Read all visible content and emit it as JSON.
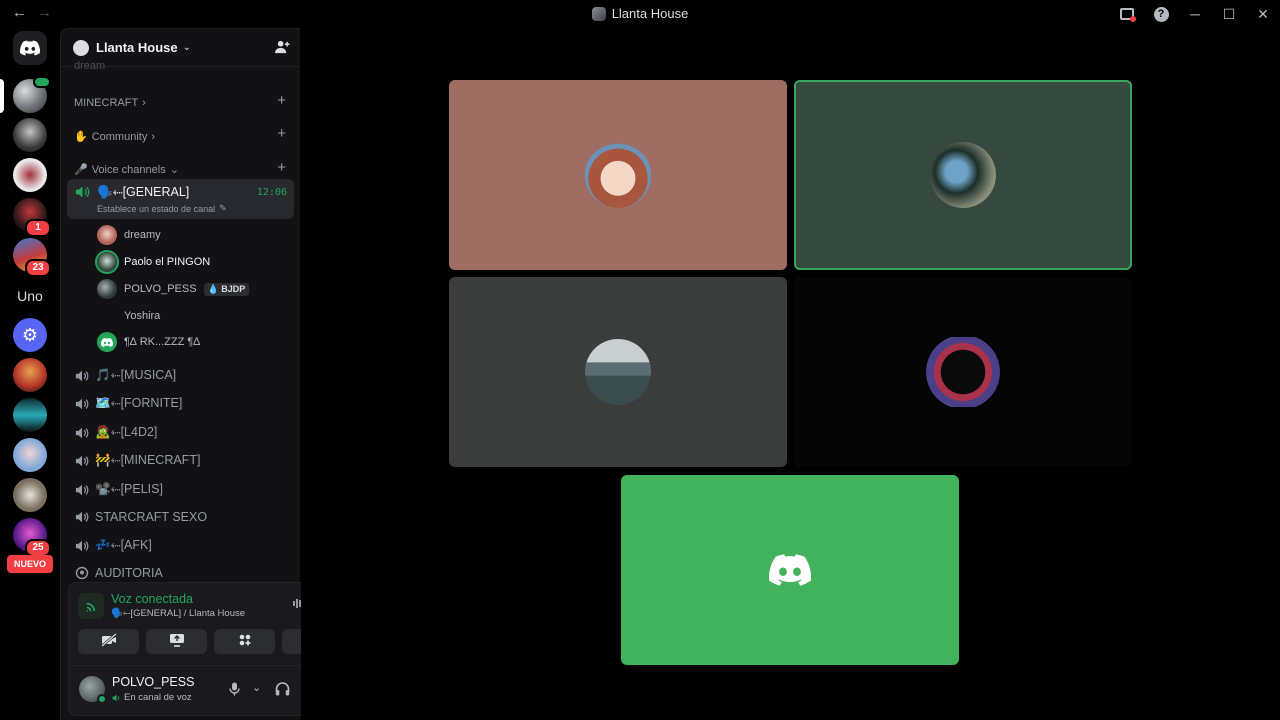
{
  "window": {
    "title": "Llanta House",
    "back": "←",
    "forward": "→",
    "help": "?",
    "minimize": "─",
    "maximize": "☐",
    "close": "✕"
  },
  "guilds": {
    "badges": [
      "1",
      "23",
      "25"
    ],
    "uno_label": "Uno",
    "new_label": "NUEVO"
  },
  "server": {
    "name": "Llanta House",
    "chevron": "⌄",
    "invite_icon": "person-add-icon"
  },
  "categories": {
    "partial_top": "dream",
    "minecraft": "MINECRAFT",
    "community": "Community",
    "voice": "Voice channels",
    "chev_right": "›",
    "chev_down": "⌄",
    "plus": "+"
  },
  "active_channel": {
    "name": "🗣️⬸[GENERAL]",
    "timer": "12:06",
    "status_placeholder": "Establece un estado de canal",
    "members": [
      {
        "name": "dreamy",
        "tag": ""
      },
      {
        "name": "Paolo el PINGON",
        "tag": ""
      },
      {
        "name": "POLVO_PESS",
        "tag": "BJDP"
      },
      {
        "name": "Yoshira",
        "tag": ""
      },
      {
        "name": "¶∆ RK...ZZZ ¶∆",
        "tag": ""
      }
    ]
  },
  "channels": [
    "🎵⬸[MUSICA]",
    "🗺️⬸[FORNITE]",
    "🧟⬸[L4D2]",
    "🚧⬸[MINECRAFT]",
    "📽️⬸[PELIS]",
    "STARCRAFT SEXO",
    "💤⬸[AFK]",
    "AUDITORIA"
  ],
  "voice_panel": {
    "status": "Voz conectada",
    "location": "🗣️⬸[GENERAL] / Llanta House"
  },
  "user": {
    "name": "POLVO_PESS",
    "status": "En canal de voz"
  },
  "colors": {
    "accent_green": "#23a55a",
    "mention_red": "#f23f43",
    "tile_pink": "#a06d65",
    "tile_green": "#35493e",
    "tile_grey": "#3a3d3b",
    "tile_dark": "#050505",
    "tile_discord": "#43b25c"
  }
}
